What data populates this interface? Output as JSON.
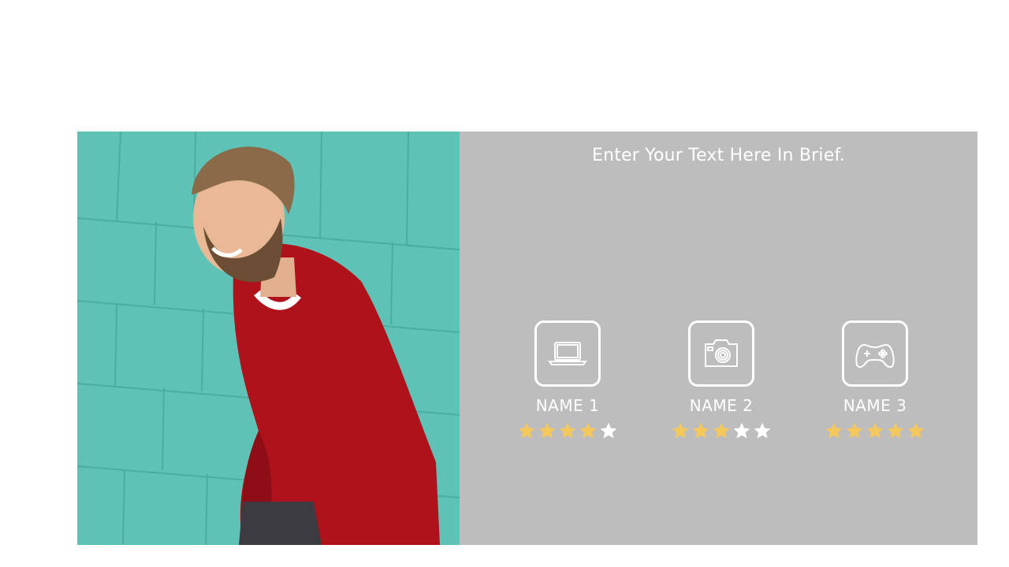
{
  "headline": "Enter Your Text Here In Brief.",
  "photo": {
    "alt_semantic": "smiling-man-red-sweater-teal-wall"
  },
  "colors": {
    "panel_bg": "#bdbdbd",
    "star_filled": "#f5c85c",
    "star_empty": "#ffffff",
    "text": "#ffffff",
    "photo_bg": "#5fc4b8"
  },
  "cards": [
    {
      "icon": "laptop-icon",
      "name": "NAME 1",
      "rating": 4,
      "max": 5
    },
    {
      "icon": "camera-icon",
      "name": "NAME 2",
      "rating": 3,
      "max": 5
    },
    {
      "icon": "gamepad-icon",
      "name": "NAME 3",
      "rating": 5,
      "max": 5
    }
  ]
}
